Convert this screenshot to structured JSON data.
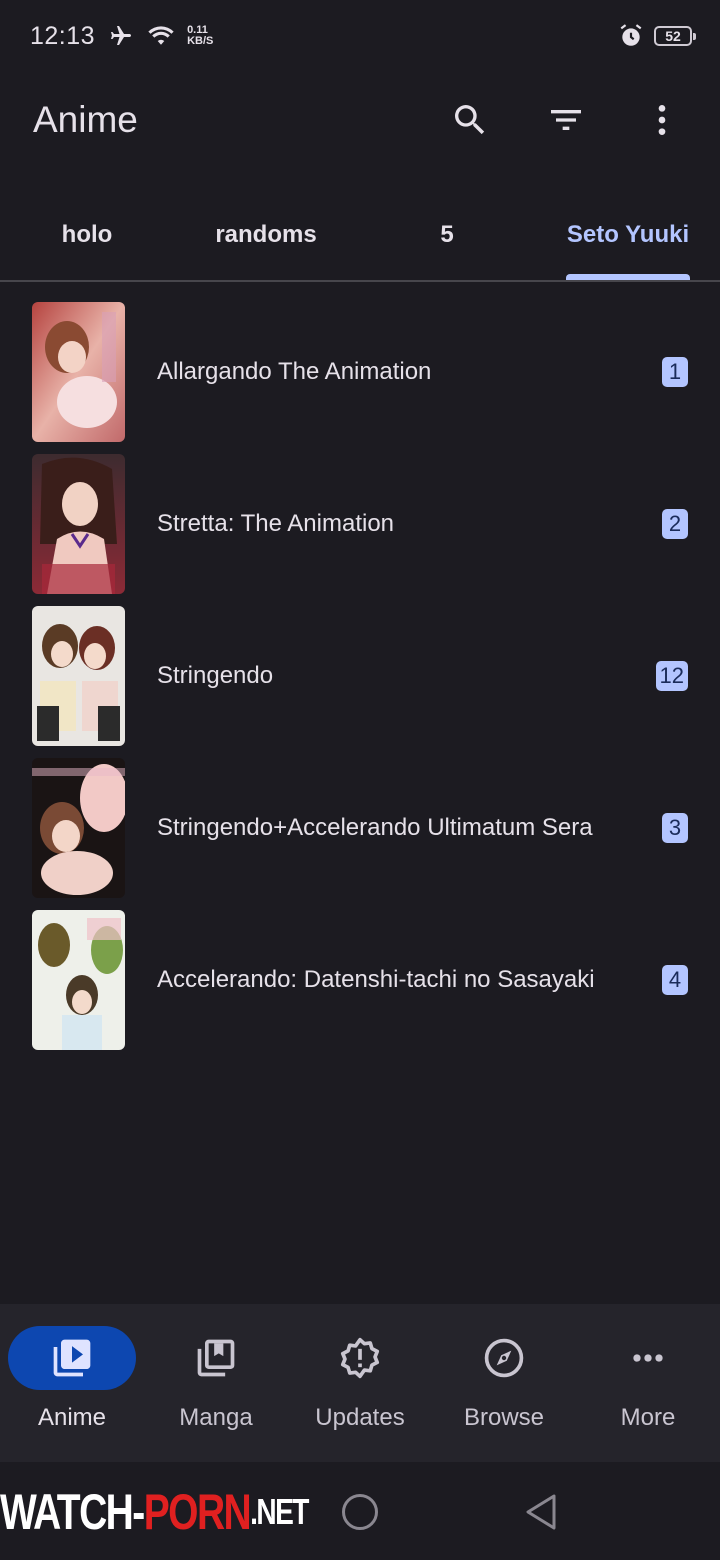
{
  "status_bar": {
    "time": "12:13",
    "net_speed_value": "0.11",
    "net_speed_unit": "KB/S",
    "battery": "52"
  },
  "app_bar": {
    "title": "Anime"
  },
  "tabs": [
    {
      "label": "holo",
      "active": false
    },
    {
      "label": "randoms",
      "active": false
    },
    {
      "label": "5",
      "active": false
    },
    {
      "label": "Seto Yuuki",
      "active": true
    }
  ],
  "items": [
    {
      "title": "Allargando The Animation",
      "badge": "1"
    },
    {
      "title": "Stretta: The Animation",
      "badge": "2"
    },
    {
      "title": "Stringendo",
      "badge": "12"
    },
    {
      "title": "Stringendo+Accelerando Ultimatum Sera",
      "badge": "3"
    },
    {
      "title": "Accelerando: Datenshi-tachi no Sasayaki",
      "badge": "4"
    }
  ],
  "bottom_nav": [
    {
      "label": "Anime",
      "icon": "video-library-icon",
      "active": true
    },
    {
      "label": "Manga",
      "icon": "collections-icon",
      "active": false
    },
    {
      "label": "Updates",
      "icon": "new-releases-icon",
      "active": false
    },
    {
      "label": "Browse",
      "icon": "explore-icon",
      "active": false
    },
    {
      "label": "More",
      "icon": "more-horiz-icon",
      "active": false
    }
  ],
  "watermark": {
    "part1": "WATCH-",
    "part2": "PORN",
    "part3": ".NET"
  },
  "colors": {
    "background": "#1c1b21",
    "accent": "#b3c5ff",
    "active_nav_pill": "#0d47b0",
    "nav_background": "#25242b"
  }
}
